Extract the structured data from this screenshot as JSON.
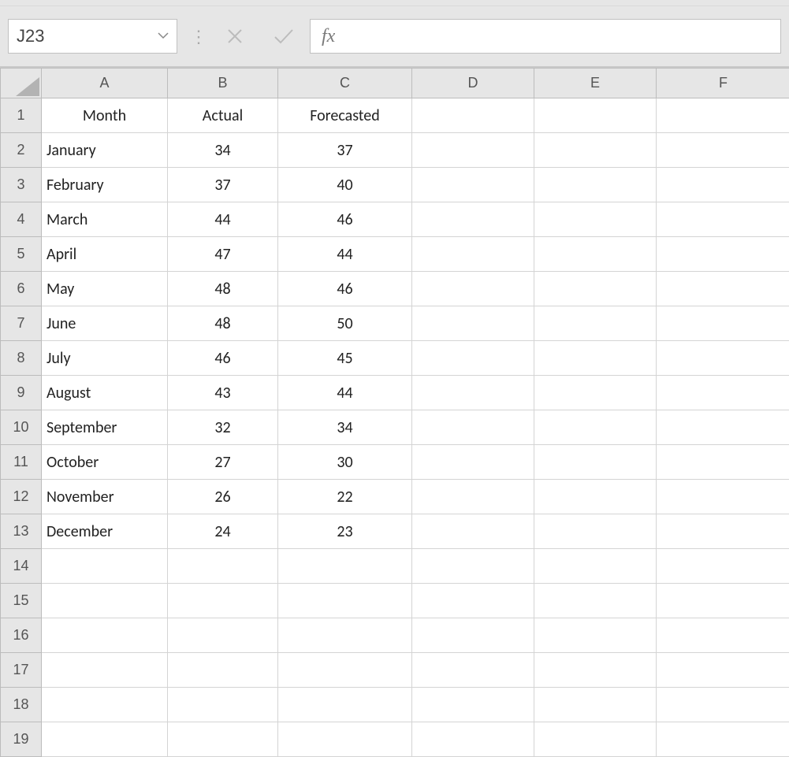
{
  "nameBox": {
    "value": "J23"
  },
  "formulaBar": {
    "fxLabel": "fx",
    "formula": ""
  },
  "columns": [
    "A",
    "B",
    "C",
    "D",
    "E",
    "F"
  ],
  "headerRow": {
    "month": "Month",
    "actual": "Actual",
    "forecasted": "Forecasted"
  },
  "rows": [
    {
      "n": "1"
    },
    {
      "n": "2",
      "month": "January",
      "actual": "34",
      "forecasted": "37"
    },
    {
      "n": "3",
      "month": "February",
      "actual": "37",
      "forecasted": "40"
    },
    {
      "n": "4",
      "month": "March",
      "actual": "44",
      "forecasted": "46"
    },
    {
      "n": "5",
      "month": "April",
      "actual": "47",
      "forecasted": "44"
    },
    {
      "n": "6",
      "month": "May",
      "actual": "48",
      "forecasted": "46"
    },
    {
      "n": "7",
      "month": "June",
      "actual": "48",
      "forecasted": "50"
    },
    {
      "n": "8",
      "month": "July",
      "actual": "46",
      "forecasted": "45"
    },
    {
      "n": "9",
      "month": "August",
      "actual": "43",
      "forecasted": "44"
    },
    {
      "n": "10",
      "month": "September",
      "actual": "32",
      "forecasted": "34"
    },
    {
      "n": "11",
      "month": "October",
      "actual": "27",
      "forecasted": "30"
    },
    {
      "n": "12",
      "month": "November",
      "actual": "26",
      "forecasted": "22"
    },
    {
      "n": "13",
      "month": "December",
      "actual": "24",
      "forecasted": "23"
    },
    {
      "n": "14"
    },
    {
      "n": "15"
    },
    {
      "n": "16"
    },
    {
      "n": "17"
    },
    {
      "n": "18"
    },
    {
      "n": "19"
    }
  ],
  "chart_data": {
    "type": "table",
    "title": "",
    "columns": [
      "Month",
      "Actual",
      "Forecasted"
    ],
    "categories": [
      "January",
      "February",
      "March",
      "April",
      "May",
      "June",
      "July",
      "August",
      "September",
      "October",
      "November",
      "December"
    ],
    "series": [
      {
        "name": "Actual",
        "values": [
          34,
          37,
          44,
          47,
          48,
          48,
          46,
          43,
          32,
          27,
          26,
          24
        ]
      },
      {
        "name": "Forecasted",
        "values": [
          37,
          40,
          46,
          44,
          46,
          50,
          45,
          44,
          34,
          30,
          22,
          23
        ]
      }
    ]
  }
}
